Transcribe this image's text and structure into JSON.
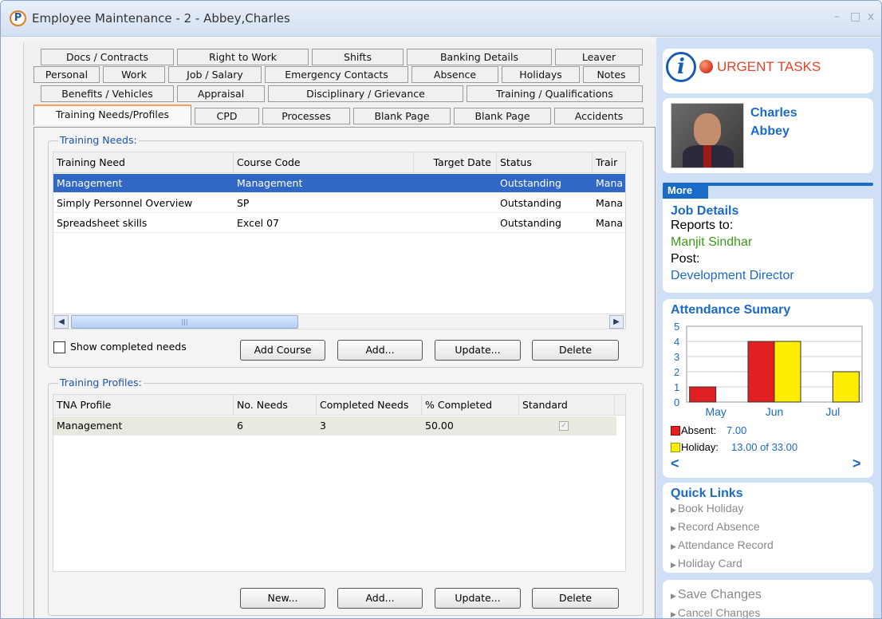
{
  "window": {
    "title": "Employee Maintenance - 2 - Abbey,Charles",
    "app_icon": "P",
    "minimize": "–",
    "maximize": "□",
    "close": "x"
  },
  "tabs": {
    "row1": [
      "Docs / Contracts",
      "Right to Work",
      "Shifts",
      "Banking Details",
      "Leaver"
    ],
    "row2": [
      "Personal",
      "Work",
      "Job / Salary",
      "Emergency Contacts",
      "Absence",
      "Holidays",
      "Notes"
    ],
    "row3": [
      "Benefits / Vehicles",
      "Appraisal",
      "Disciplinary / Grievance",
      "Training / Qualifications"
    ],
    "row4": [
      "Training Needs/Profiles",
      "CPD",
      "Processes",
      "Blank Page",
      "Blank Page",
      "Accidents"
    ],
    "active": "Training Needs/Profiles"
  },
  "training_needs": {
    "legend": "Training Needs:",
    "columns": [
      "Training Need",
      "Course Code",
      "Target Date",
      "Status",
      "Trair"
    ],
    "rows": [
      {
        "need": "Management",
        "code": "Management",
        "target": "",
        "status": "Outstanding",
        "trainer": "Mana"
      },
      {
        "need": "Simply Personnel Overview",
        "code": "SP",
        "target": "",
        "status": "Outstanding",
        "trainer": "Mana"
      },
      {
        "need": "Spreadsheet skills",
        "code": "Excel 07",
        "target": "",
        "status": "Outstanding",
        "trainer": "Mana"
      }
    ],
    "show_completed_label": "Show completed needs",
    "show_completed_checked": false,
    "buttons": {
      "add_course": "Add Course",
      "add": "Add...",
      "update": "Update...",
      "delete": "Delete"
    }
  },
  "training_profiles": {
    "legend": "Training Profiles:",
    "columns": [
      "TNA Profile",
      "No. Needs",
      "Completed Needs",
      "% Completed",
      "Standard"
    ],
    "rows": [
      {
        "profile": "Management",
        "needs": "6",
        "completed": "3",
        "percent": "50.00",
        "standard": true
      }
    ],
    "buttons": {
      "new": "New...",
      "add": "Add...",
      "update": "Update...",
      "delete": "Delete"
    }
  },
  "sidebar": {
    "urgent_label": "URGENT TASKS",
    "employee": {
      "first": "Charles",
      "last": "Abbey"
    },
    "more_tab": "More",
    "job": {
      "heading": "Job Details",
      "reports_label": "Reports to:",
      "reports_value": "Manjit Sindhar",
      "post_label": "Post:",
      "post_value": "Development Director"
    },
    "quick_links": {
      "heading": "Quick Links",
      "items": [
        "Book Holiday",
        "Record Absence",
        "Attendance Record",
        "Holiday Card"
      ]
    },
    "actions": [
      "Save Changes",
      "Cancel Changes"
    ],
    "colors": {
      "accent": "#1a6ac8",
      "urgent": "#e0452a",
      "green": "#3a9a1a"
    }
  },
  "chart_data": {
    "type": "bar",
    "title": "Attendance Sumary",
    "categories": [
      "May",
      "Jun",
      "Jul"
    ],
    "series": [
      {
        "name": "Absent",
        "values": [
          1,
          4,
          0
        ],
        "color": "#e02020"
      },
      {
        "name": "Holiday",
        "values": [
          0,
          4,
          2
        ],
        "color": "#ffee00"
      }
    ],
    "ylim": [
      0,
      5
    ],
    "yticks": [
      "0",
      "1",
      "2",
      "3",
      "4",
      "5"
    ],
    "legend": [
      {
        "label": "Absent:",
        "value": "7.00"
      },
      {
        "label": "Holiday:",
        "value": "13.00 of 33.00"
      }
    ],
    "nav": {
      "prev": "<",
      "next": ">"
    }
  }
}
